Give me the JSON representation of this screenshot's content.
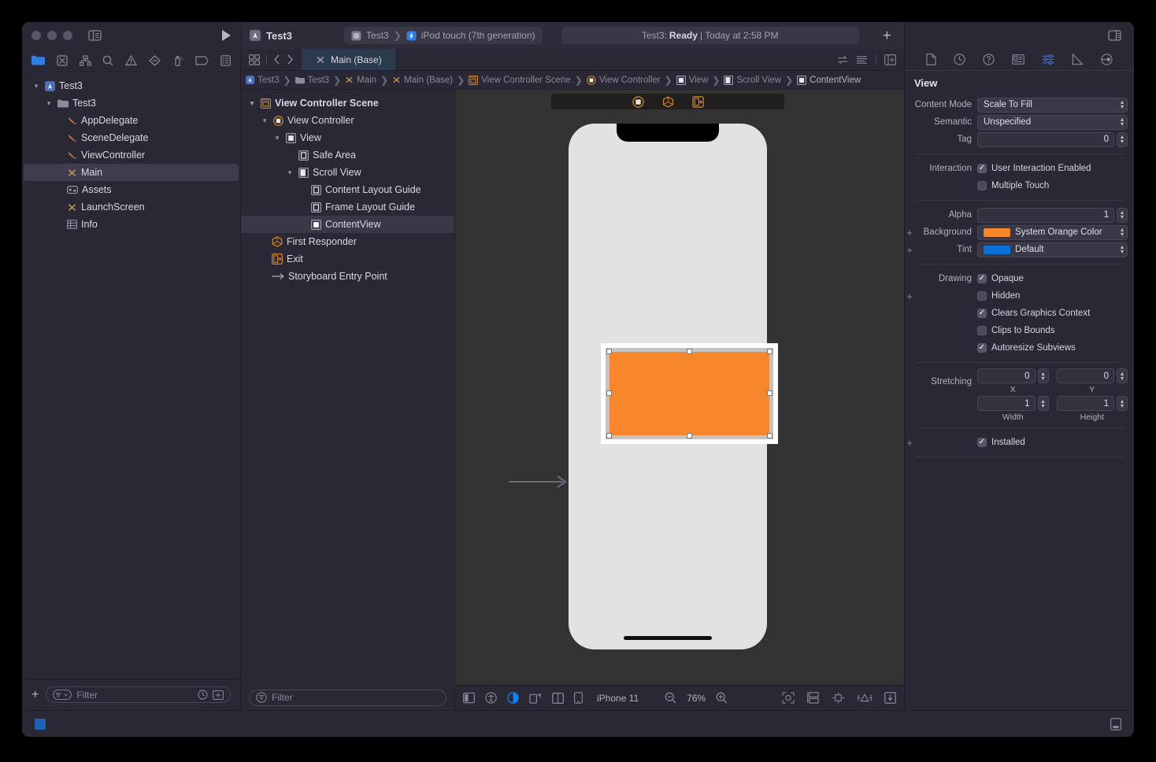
{
  "window": {
    "title": "Test3",
    "traffic_lights": [
      "close",
      "minimize",
      "zoom"
    ]
  },
  "toolbar": {
    "project_name": "Test3",
    "scheme_name": "Test3",
    "destination": "iPod touch (7th generation)",
    "status_prefix": "Test3:",
    "status_state": "Ready",
    "status_suffix": "| Today at 2:58 PM",
    "add_button": "+"
  },
  "navigator": {
    "toolbar_icons": [
      "folder-icon",
      "source-control-icon",
      "symbol-hierarchy-icon",
      "find-icon",
      "issue-warning-icon",
      "test-diamond-icon",
      "debug-icon",
      "breakpoint-icon",
      "report-icon"
    ],
    "items": [
      {
        "label": "Test3",
        "icon": "xcode-project-icon",
        "depth": 0,
        "twisty": "open",
        "selected": false
      },
      {
        "label": "Test3",
        "icon": "folder-icon",
        "depth": 1,
        "twisty": "open",
        "selected": false
      },
      {
        "label": "AppDelegate",
        "icon": "swift-file-icon",
        "depth": 2,
        "twisty": "",
        "selected": false
      },
      {
        "label": "SceneDelegate",
        "icon": "swift-file-icon",
        "depth": 2,
        "twisty": "",
        "selected": false
      },
      {
        "label": "ViewController",
        "icon": "swift-file-icon",
        "depth": 2,
        "twisty": "",
        "selected": false
      },
      {
        "label": "Main",
        "icon": "storyboard-icon",
        "depth": 2,
        "twisty": "",
        "selected": true
      },
      {
        "label": "Assets",
        "icon": "assets-catalog-icon",
        "depth": 2,
        "twisty": "",
        "selected": false
      },
      {
        "label": "LaunchScreen",
        "icon": "storyboard-icon",
        "depth": 2,
        "twisty": "",
        "selected": false
      },
      {
        "label": "Info",
        "icon": "plist-icon",
        "depth": 2,
        "twisty": "",
        "selected": false
      }
    ],
    "filter_placeholder": "Filter",
    "add_label": "+"
  },
  "outline": {
    "items": [
      {
        "label": "View Controller Scene",
        "icon": "scene-icon",
        "depth": 0,
        "twisty": "open",
        "selected": false,
        "bold": true
      },
      {
        "label": "View Controller",
        "icon": "view-controller-icon",
        "depth": 1,
        "twisty": "open",
        "selected": false
      },
      {
        "label": "View",
        "icon": "view-icon",
        "depth": 2,
        "twisty": "open",
        "selected": false
      },
      {
        "label": "Safe Area",
        "icon": "layout-guide-icon",
        "depth": 3,
        "twisty": "",
        "selected": false
      },
      {
        "label": "Scroll View",
        "icon": "scroll-view-icon",
        "depth": 3,
        "twisty": "open",
        "selected": false
      },
      {
        "label": "Content Layout Guide",
        "icon": "layout-guide-icon",
        "depth": 4,
        "twisty": "",
        "selected": false
      },
      {
        "label": "Frame Layout Guide",
        "icon": "layout-guide-icon",
        "depth": 4,
        "twisty": "",
        "selected": false
      },
      {
        "label": "ContentView",
        "icon": "view-icon",
        "depth": 4,
        "twisty": "",
        "selected": true
      },
      {
        "label": "First Responder",
        "icon": "first-responder-icon",
        "depth": 1,
        "twisty": "",
        "selected": false
      },
      {
        "label": "Exit",
        "icon": "exit-icon",
        "depth": 1,
        "twisty": "",
        "selected": false
      },
      {
        "label": "Storyboard Entry Point",
        "icon": "entry-point-arrow-icon",
        "depth": 1,
        "twisty": "",
        "selected": false
      }
    ],
    "filter_placeholder": "Filter"
  },
  "editor": {
    "tab_label": "Main (Base)",
    "breadcrumbs": [
      {
        "label": "Test3",
        "icon": "xcode-project-icon"
      },
      {
        "label": "Test3",
        "icon": "folder-icon"
      },
      {
        "label": "Main",
        "icon": "storyboard-icon"
      },
      {
        "label": "Main (Base)",
        "icon": "storyboard-icon"
      },
      {
        "label": "View Controller Scene",
        "icon": "scene-icon"
      },
      {
        "label": "View Controller",
        "icon": "view-controller-icon"
      },
      {
        "label": "View",
        "icon": "view-icon"
      },
      {
        "label": "Scroll View",
        "icon": "scroll-view-icon"
      },
      {
        "label": "ContentView",
        "icon": "view-icon"
      }
    ]
  },
  "canvas": {
    "device_label": "iPhone 11",
    "zoom_level": "76%",
    "content_view_color": "#F8862B",
    "scene_dock_icons": [
      "view-controller-dock-icon",
      "first-responder-dock-icon",
      "exit-dock-icon"
    ],
    "bottom_icons": [
      "device-bezel-icon",
      "accessibility-icon",
      "appearance-icon",
      "orientation-icon",
      "split-view-icon",
      "device-icon"
    ],
    "right_icons": [
      "update-frames-icon",
      "embed-in-icon",
      "align-icon",
      "add-constraints-icon",
      "resolve-issues-icon"
    ],
    "zoom_out_icon": "zoom-out-icon",
    "zoom_in_icon": "zoom-in-icon"
  },
  "inspector": {
    "tabs": [
      "file-inspector-icon",
      "history-inspector-icon",
      "quick-help-icon",
      "identity-inspector-icon",
      "attributes-inspector-icon",
      "size-inspector-icon",
      "connections-inspector-icon"
    ],
    "selected_tab_index": 4,
    "section_title": "View",
    "content_mode": {
      "label": "Content Mode",
      "value": "Scale To Fill"
    },
    "semantic": {
      "label": "Semantic",
      "value": "Unspecified"
    },
    "tag": {
      "label": "Tag",
      "value": "0"
    },
    "interaction": {
      "label": "Interaction",
      "options": [
        {
          "label": "User Interaction Enabled",
          "checked": true
        },
        {
          "label": "Multiple Touch",
          "checked": false
        }
      ]
    },
    "alpha": {
      "label": "Alpha",
      "value": "1"
    },
    "background": {
      "label": "Background",
      "value": "System Orange Color",
      "swatch": "#F8862B"
    },
    "tint": {
      "label": "Tint",
      "value": "Default",
      "swatch": "#0a6fd8"
    },
    "drawing": {
      "label": "Drawing",
      "options": [
        {
          "label": "Opaque",
          "checked": true
        },
        {
          "label": "Hidden",
          "checked": false
        },
        {
          "label": "Clears Graphics Context",
          "checked": true
        },
        {
          "label": "Clips to Bounds",
          "checked": false
        },
        {
          "label": "Autoresize Subviews",
          "checked": true
        }
      ]
    },
    "stretching": {
      "label": "Stretching",
      "fields": [
        {
          "sublabel": "X",
          "value": "0"
        },
        {
          "sublabel": "Y",
          "value": "0"
        },
        {
          "sublabel": "Width",
          "value": "1"
        },
        {
          "sublabel": "Height",
          "value": "1"
        }
      ]
    },
    "installed": {
      "label": "Installed",
      "checked": true
    }
  }
}
